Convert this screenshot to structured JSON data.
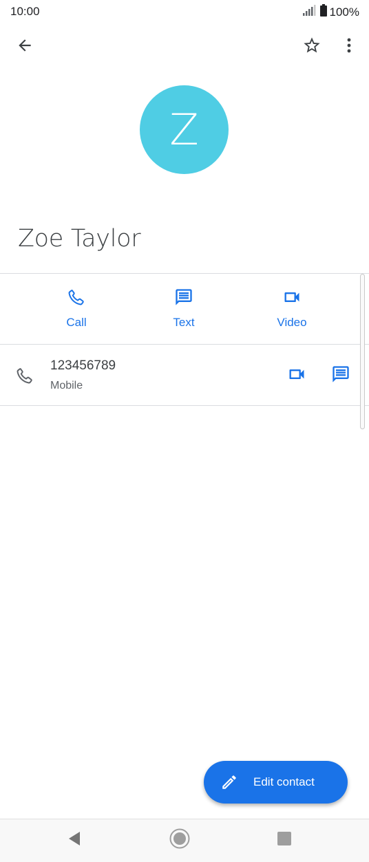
{
  "status_bar": {
    "time": "10:00",
    "battery": "100%",
    "icons": [
      "signal-icon",
      "battery-icon"
    ]
  },
  "top_bar": {
    "icons": [
      "back-arrow-icon",
      "star-outline-icon",
      "more-vert-icon"
    ]
  },
  "contact": {
    "avatar_letter": "Z",
    "avatar_color": "#4fcde4",
    "name": "Zoe Taylor"
  },
  "actions": [
    {
      "label": "Call",
      "icon": "phone-icon"
    },
    {
      "label": "Text",
      "icon": "message-icon"
    },
    {
      "label": "Video",
      "icon": "videocam-icon"
    }
  ],
  "phone_entry": {
    "number": "123456789",
    "type": "Mobile"
  },
  "fab": {
    "label": "Edit contact",
    "icon": "pencil-icon"
  },
  "navigation": {
    "icons": [
      "nav-back-icon",
      "nav-home-icon",
      "nav-recents-icon"
    ]
  },
  "colors": {
    "accent": "#1a73e8",
    "avatar": "#4fcde4"
  }
}
